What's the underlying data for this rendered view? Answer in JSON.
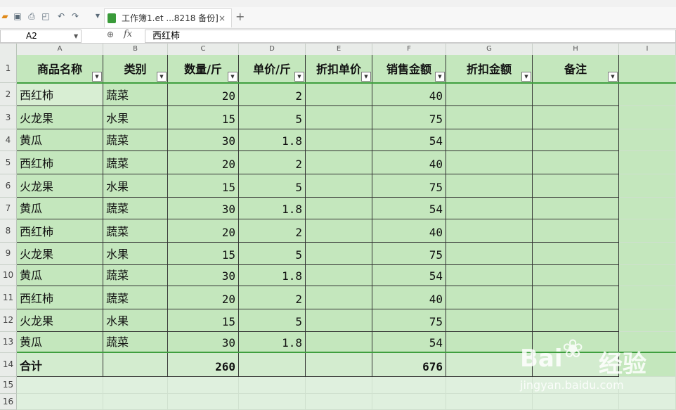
{
  "toolbar": {
    "tab_title": "工作簿1.et ...8218 备份]",
    "tab_close": "×",
    "tab_add": "+",
    "icons": [
      "folder-open-icon",
      "save-icon",
      "print-icon",
      "print-preview-icon",
      "undo-icon",
      "redo-icon",
      "dropdown-icon"
    ]
  },
  "formula_bar": {
    "name_box": "A2",
    "fx": "fx",
    "value": "西红柿"
  },
  "columns": [
    "A",
    "B",
    "C",
    "D",
    "E",
    "F",
    "G",
    "H",
    "I"
  ],
  "rows": [
    "1",
    "2",
    "3",
    "4",
    "5",
    "6",
    "7",
    "8",
    "9",
    "10",
    "11",
    "12",
    "13",
    "14",
    "15",
    "16"
  ],
  "table": {
    "headers": [
      "商品名称",
      "类别",
      "数量/斤",
      "单价/斤",
      "折扣单价",
      "销售金额",
      "折扣金额",
      "备注"
    ],
    "data": [
      [
        "西红柿",
        "蔬菜",
        "20",
        "2",
        "",
        "40",
        "",
        ""
      ],
      [
        "火龙果",
        "水果",
        "15",
        "5",
        "",
        "75",
        "",
        ""
      ],
      [
        "黄瓜",
        "蔬菜",
        "30",
        "1.8",
        "",
        "54",
        "",
        ""
      ],
      [
        "西红柿",
        "蔬菜",
        "20",
        "2",
        "",
        "40",
        "",
        ""
      ],
      [
        "火龙果",
        "水果",
        "15",
        "5",
        "",
        "75",
        "",
        ""
      ],
      [
        "黄瓜",
        "蔬菜",
        "30",
        "1.8",
        "",
        "54",
        "",
        ""
      ],
      [
        "西红柿",
        "蔬菜",
        "20",
        "2",
        "",
        "40",
        "",
        ""
      ],
      [
        "火龙果",
        "水果",
        "15",
        "5",
        "",
        "75",
        "",
        ""
      ],
      [
        "黄瓜",
        "蔬菜",
        "30",
        "1.8",
        "",
        "54",
        "",
        ""
      ],
      [
        "西红柿",
        "蔬菜",
        "20",
        "2",
        "",
        "40",
        "",
        ""
      ],
      [
        "火龙果",
        "水果",
        "15",
        "5",
        "",
        "75",
        "",
        ""
      ],
      [
        "黄瓜",
        "蔬菜",
        "30",
        "1.8",
        "",
        "54",
        "",
        ""
      ]
    ],
    "total": [
      "合计",
      "",
      "260",
      "",
      "",
      "676",
      "",
      ""
    ]
  },
  "watermark": {
    "brand": "Bai",
    "brand_cn": "经验",
    "url": "jingyan.baidu.com"
  },
  "colors": {
    "cell_bg": "#c4e7bd",
    "sheet_bg": "#dff0de",
    "accent_line": "#3f9f3f"
  }
}
